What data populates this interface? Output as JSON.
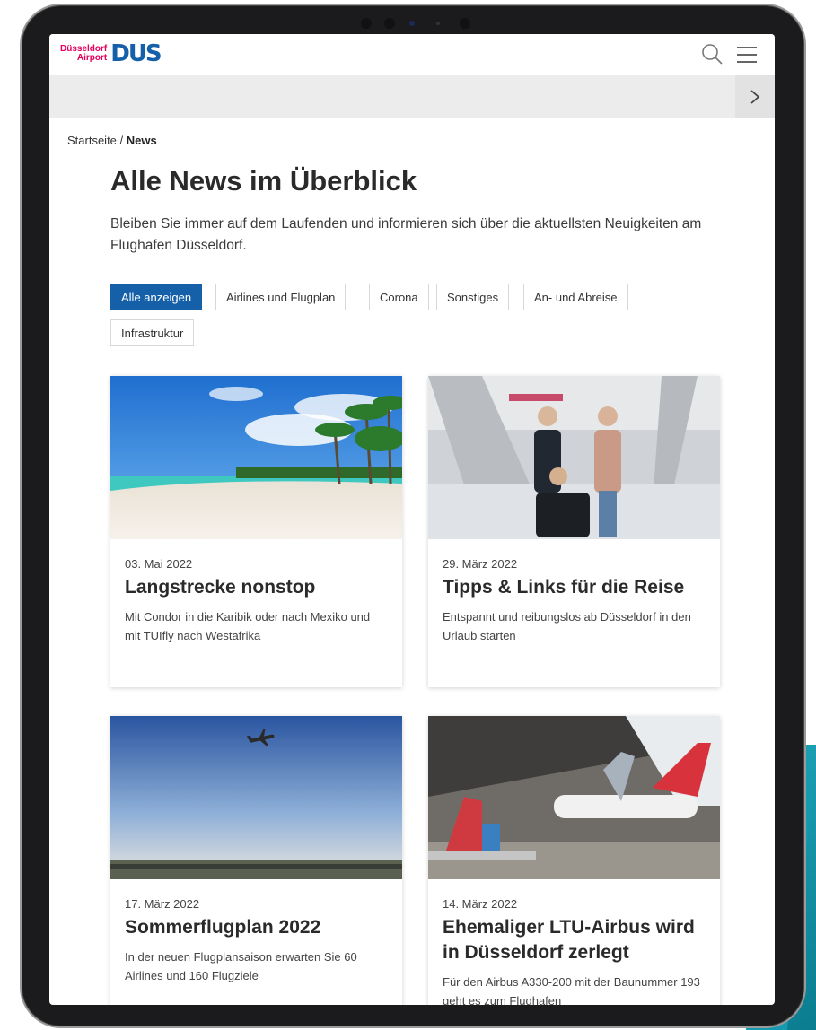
{
  "header": {
    "logo_line1": "Düsseldorf",
    "logo_line2": "Airport",
    "logo_mark": "DUS",
    "search_icon": "search-icon",
    "menu_icon": "hamburger-menu-icon"
  },
  "strip": {
    "arrow_icon": "chevron-right-icon"
  },
  "breadcrumb": {
    "home": "Startseite",
    "separator": " / ",
    "current": "News"
  },
  "page": {
    "title": "Alle News im Überblick",
    "intro": "Bleiben Sie immer auf dem Laufenden und informieren sich über die aktuellsten Neuigkeiten am Flughafen Düsseldorf."
  },
  "filters": [
    {
      "label": "Alle anzeigen",
      "active": true
    },
    {
      "label": "Airlines und Flugplan",
      "active": false
    },
    {
      "label": "Corona",
      "active": false
    },
    {
      "label": "Sonstiges",
      "active": false
    },
    {
      "label": "An- und Abreise",
      "active": false
    },
    {
      "label": "Infrastruktur",
      "active": false
    }
  ],
  "cards": [
    {
      "date": "03. Mai 2022",
      "title": "Langstrecke nonstop",
      "desc": "Mit Condor in die Karibik oder nach Mexiko und mit TUIfly nach Westafrika"
    },
    {
      "date": "29. März 2022",
      "title": "Tipps & Links für die Reise",
      "desc": "Entspannt und reibungslos ab Düsseldorf in den Urlaub starten"
    },
    {
      "date": "17. März 2022",
      "title": "Sommerflugplan 2022",
      "desc": "In der neuen Flugplansaison erwarten Sie 60 Airlines und 160 Flugziele"
    },
    {
      "date": "14. März 2022",
      "title": "Ehemaliger LTU-Airbus wird in Düsseldorf zerlegt",
      "desc": "Für den Airbus A330-200 mit der Baunummer 193 geht es zum Flughafen"
    }
  ],
  "colors": {
    "brand_blue": "#1560a8",
    "brand_pink": "#e4005c",
    "accent_teal": "#159ab0"
  }
}
